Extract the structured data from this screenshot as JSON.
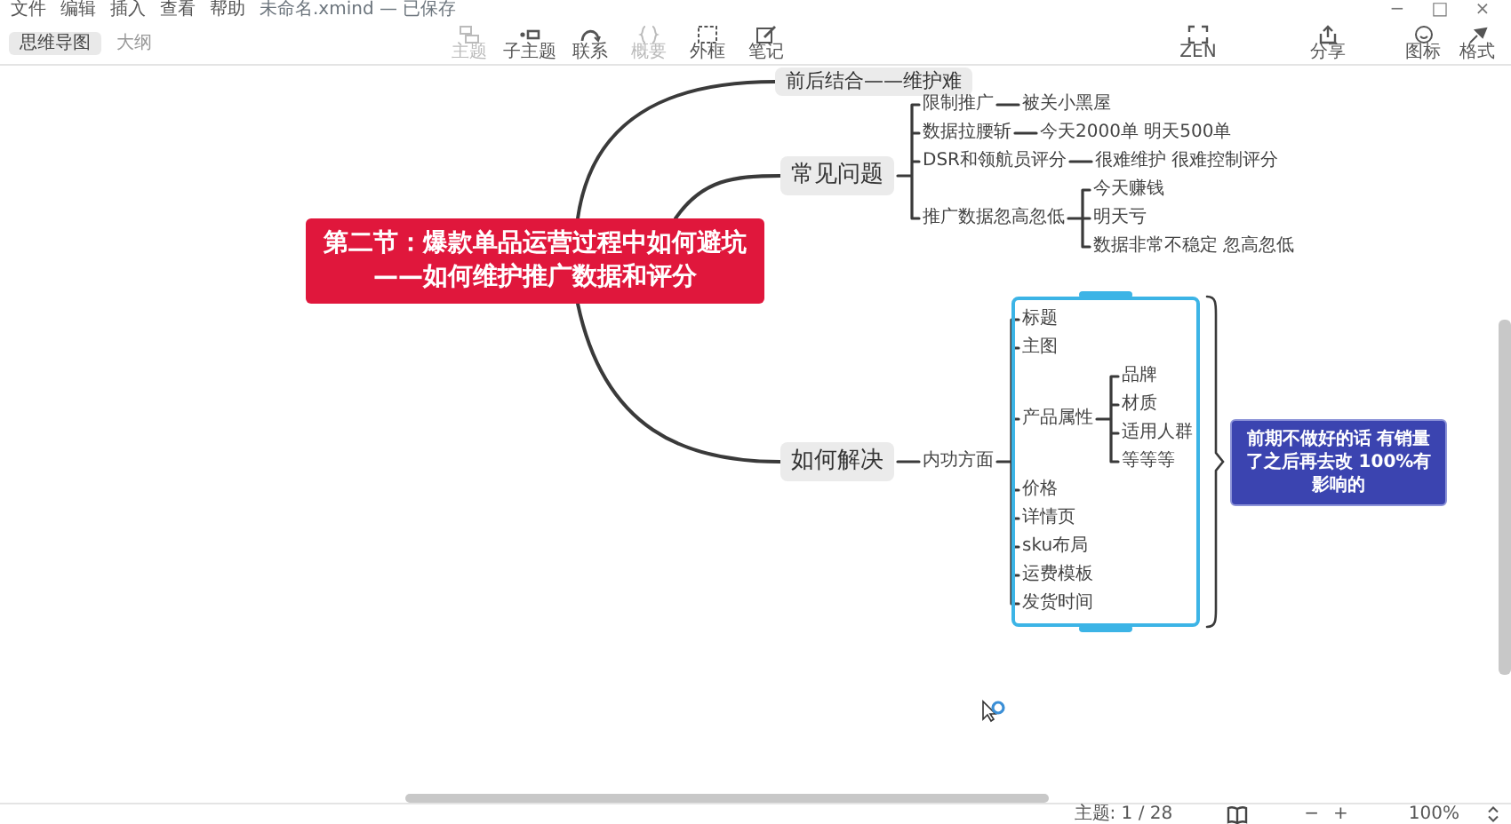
{
  "menu": [
    {
      "label": "文件"
    },
    {
      "label": "编辑"
    },
    {
      "label": "插入"
    },
    {
      "label": "查看"
    },
    {
      "label": "帮助"
    }
  ],
  "document_title": "未命名.xmind — 已保存",
  "window_controls": [
    "−",
    "□",
    "×"
  ],
  "view_tabs": [
    {
      "label": "思维导图",
      "selected": true
    },
    {
      "label": "大纲",
      "selected": false
    }
  ],
  "toolbar": [
    {
      "label": "主题",
      "disabled": true
    },
    {
      "label": "子主题",
      "disabled": false
    },
    {
      "label": "联系",
      "disabled": false
    },
    {
      "label": "概要",
      "disabled": true
    },
    {
      "label": "外框",
      "disabled": false
    },
    {
      "label": "笔记",
      "disabled": false
    }
  ],
  "center_tools": [
    {
      "label": "ZEN"
    },
    {
      "label": "分享"
    }
  ],
  "side_tools": [
    {
      "label": "图标"
    },
    {
      "label": "格式"
    }
  ],
  "mind_map": {
    "central_topic": [
      "第二节：爆款单品运营过程中如何避坑",
      "——如何维护推广数据和评分"
    ],
    "branches": [
      {
        "text": "前后结合——维护难"
      },
      {
        "text": "常见问题",
        "children": [
          {
            "text": "限制推广",
            "children": [
              {
                "text": "被关小黑屋"
              }
            ]
          },
          {
            "text": "数据拉腰斩",
            "children": [
              {
                "text": "今天2000单 明天500单"
              }
            ]
          },
          {
            "text": "DSR和领航员评分",
            "children": [
              {
                "text": "很难维护 很难控制评分"
              }
            ]
          },
          {
            "text": "推广数据忽高忽低",
            "children": [
              {
                "text": "今天赚钱"
              },
              {
                "text": "明天亏"
              },
              {
                "text": "数据非常不稳定 忽高忽低"
              }
            ]
          }
        ]
      },
      {
        "text": "如何解决",
        "children": [
          {
            "text": "内功方面",
            "boundary_selected": true,
            "summary": "前期不做好的话 有销量了之后再去改 100%有影响的",
            "children": [
              {
                "text": "标题"
              },
              {
                "text": "主图"
              },
              {
                "text": "产品属性",
                "children": [
                  {
                    "text": "品牌"
                  },
                  {
                    "text": "材质"
                  },
                  {
                    "text": "适用人群"
                  },
                  {
                    "text": "等等等"
                  }
                ]
              },
              {
                "text": "价格"
              },
              {
                "text": "详情页"
              },
              {
                "text": "sku布局"
              },
              {
                "text": "运费模板"
              },
              {
                "text": "发货时间"
              }
            ]
          }
        ]
      }
    ]
  },
  "status_bar": {
    "topic_count": "主题: 1 / 28",
    "zoom_out": "−",
    "zoom_in": "+",
    "zoom": "100%"
  }
}
